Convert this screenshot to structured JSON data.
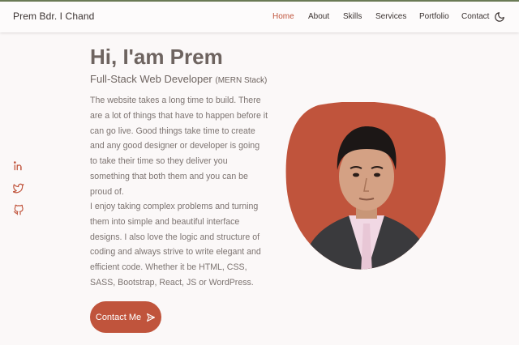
{
  "brand": "Prem Bdr. I Chand",
  "nav": {
    "home": "Home",
    "about": "About",
    "skills": "Skills",
    "services": "Services",
    "portfolio": "Portfolio",
    "contact": "Contact",
    "active": "Home"
  },
  "icons": {
    "theme_toggle": "moon-icon",
    "social": [
      "linkedin-icon",
      "twitter-icon",
      "github-icon"
    ]
  },
  "hero": {
    "title": "Hi, I'am Prem",
    "subtitle": "Full-Stack Web Developer",
    "subtitle_note": "(MERN Stack)",
    "paragraph1": "The website takes a long time to build. There are a lot of things that have to happen before it can go live. Good things take time to create and any good designer or developer is going to take their time so they deliver you something that both them and you can be proud of.",
    "paragraph2": "I enjoy taking complex problems and turning them into simple and beautiful interface designs. I also love the logic and structure of coding and always strive to write elegant and efficient code. Whether it be HTML, CSS, SASS, Bootstrap, React, JS or WordPress.",
    "cta": "Contact Me"
  },
  "colors": {
    "accent": "#c0543c",
    "text": "#6e6460",
    "background": "#fbf8f8"
  }
}
